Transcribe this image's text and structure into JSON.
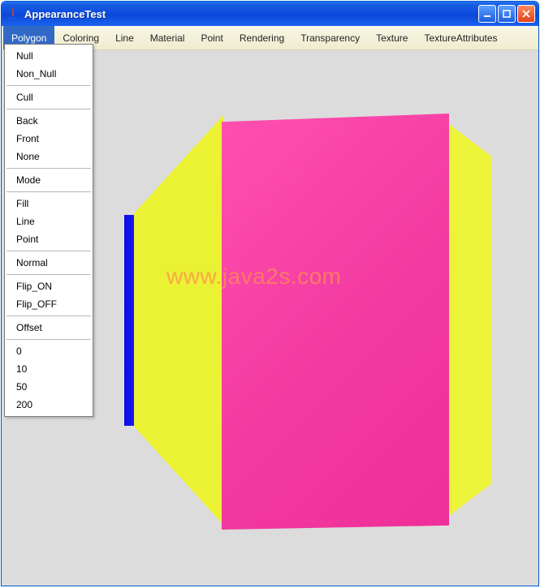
{
  "window": {
    "title": "AppearanceTest"
  },
  "menubar": {
    "items": [
      {
        "label": "Polygon",
        "active": true
      },
      {
        "label": "Coloring"
      },
      {
        "label": "Line"
      },
      {
        "label": "Material"
      },
      {
        "label": "Point"
      },
      {
        "label": "Rendering"
      },
      {
        "label": "Transparency"
      },
      {
        "label": "Texture"
      },
      {
        "label": "TextureAttributes"
      }
    ]
  },
  "dropdown": {
    "groups": [
      [
        "Null",
        "Non_Null"
      ],
      [
        "Cull"
      ],
      [
        "Back",
        "Front",
        "None"
      ],
      [
        "Mode"
      ],
      [
        "Fill",
        "Line",
        "Point"
      ],
      [
        "Normal"
      ],
      [
        "Flip_ON",
        "Flip_OFF"
      ],
      [
        "Offset"
      ],
      [
        "0",
        "10",
        "50",
        "200"
      ]
    ]
  },
  "watermark": "www.java2s.com"
}
